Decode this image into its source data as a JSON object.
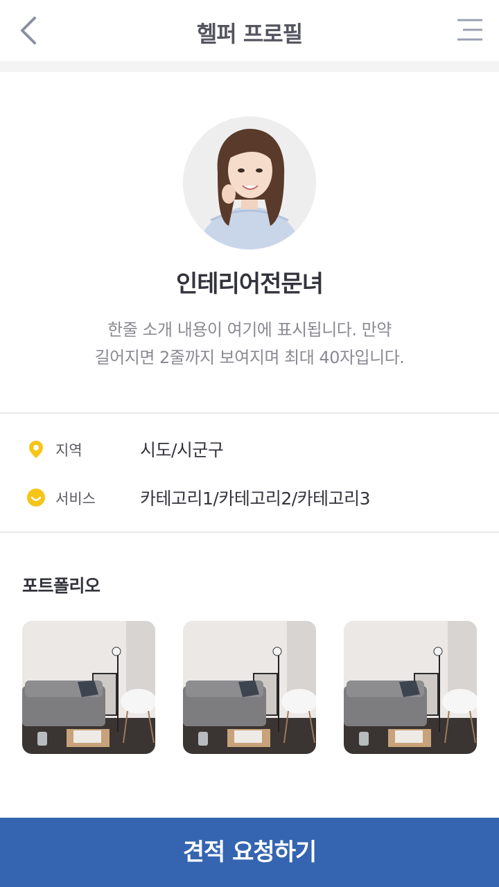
{
  "header": {
    "title": "헬퍼 프로필"
  },
  "profile": {
    "name": "인테리어전문녀",
    "intro_line1": "한줄 소개 내용이 여기에 표시됩니다. 만약",
    "intro_line2": "길어지면 2줄까지 보여지며 최대 40자입니다."
  },
  "info": {
    "region_label": "지역",
    "region_value": "시도/시군구",
    "service_label": "서비스",
    "service_value": "카테고리1/카테고리2/카테고리3"
  },
  "portfolio": {
    "title": "포트폴리오",
    "items": [
      "photo-1",
      "photo-2",
      "photo-3"
    ]
  },
  "cta": {
    "label": "견적 요청하기"
  },
  "colors": {
    "accent": "#3565b0",
    "icon_yellow": "#f5c518"
  }
}
